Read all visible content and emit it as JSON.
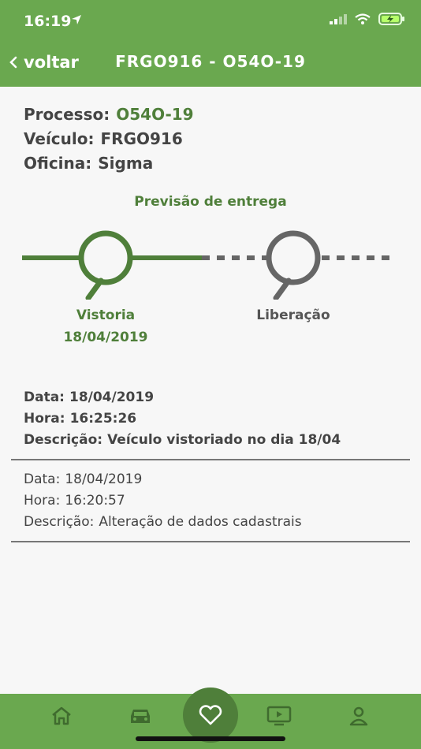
{
  "status": {
    "time": "16:19"
  },
  "nav": {
    "back_label": "voltar",
    "title": "FRGO916 - O54O-19"
  },
  "info": {
    "processo_label": "Processo:",
    "processo_value": "O54O-19",
    "veiculo_label": "Veículo:",
    "veiculo_value": "FRGO916",
    "oficina_label": "Oficina:",
    "oficina_value": "Sigma"
  },
  "forecast_label": "Previsão de entrega",
  "timeline": [
    {
      "label": "Vistoria",
      "date": "18/04/2019",
      "done": true
    },
    {
      "label": "Liberação",
      "date": "",
      "done": false
    }
  ],
  "entries": [
    {
      "data_label": "Data:",
      "data": "18/04/2019",
      "hora_label": "Hora:",
      "hora": "16:25:26",
      "desc_label": "Descrição:",
      "desc": "Veículo vistoriado no dia 18/04"
    },
    {
      "data_label": "Data:",
      "data": "18/04/2019",
      "hora_label": "Hora:",
      "hora": "16:20:57",
      "desc_label": "Descrição:",
      "desc": "Alteração de dados cadastrais"
    }
  ],
  "colors": {
    "primary": "#6aa84f",
    "dark_green": "#4f7f3a",
    "pending": "#666666",
    "text": "#444444"
  },
  "tabs": [
    {
      "icon": "home-icon"
    },
    {
      "icon": "car-icon"
    },
    {
      "icon": "heart-icon",
      "active": true
    },
    {
      "icon": "video-icon"
    },
    {
      "icon": "user-icon"
    }
  ]
}
